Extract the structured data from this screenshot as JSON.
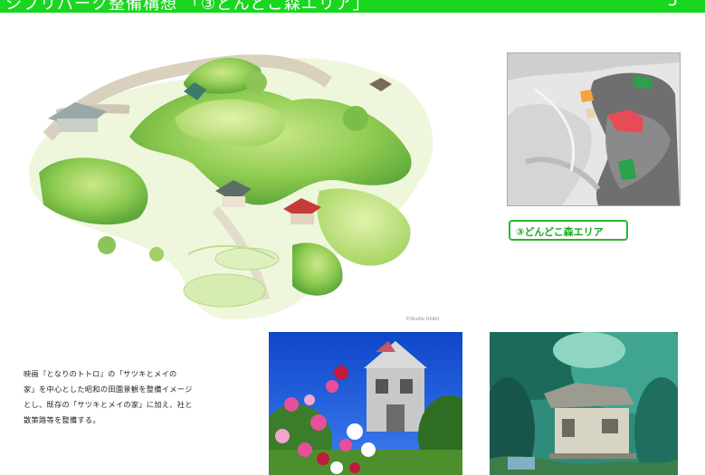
{
  "header": {
    "title": "シブリパーク整備構想 「③どんどこ森エリア」",
    "page_number": "5",
    "background_color": "#19d61f"
  },
  "illustration": {
    "credit": "©Studio Ghibli"
  },
  "area_map": {
    "label": "③どんどこ森エリア",
    "highlight_colors": [
      "#2aa14a",
      "#e84b55",
      "#f4a341",
      "#e9d6b0"
    ]
  },
  "description": {
    "lines": [
      "映画『となりのトトロ』の「サツキとメイの",
      "家」を中心とした昭和の田園景観を整備イメージ",
      "とし、既存の「サツキとメイの家」に加え、社と",
      "散策路等を整備する。"
    ]
  }
}
